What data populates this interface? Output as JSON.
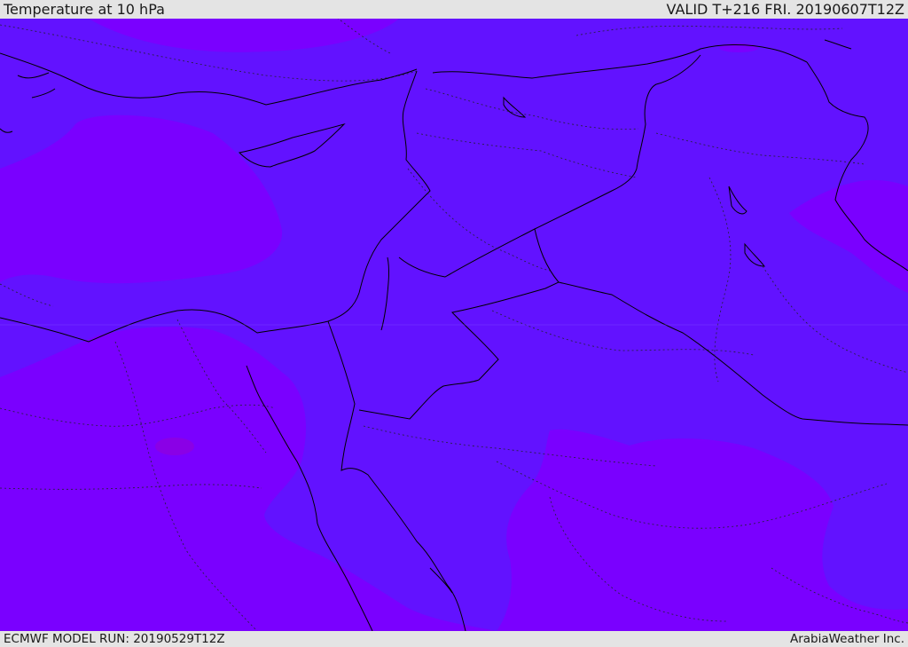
{
  "header": {
    "title": "Temperature at 10 hPa",
    "valid_time": "VALID T+216 FRI. 20190607T12Z"
  },
  "footer": {
    "model_run": "ECMWF MODEL RUN: 20190529T12Z",
    "credit": "ArabiaWeather Inc."
  },
  "map": {
    "field": "Temperature at 10 hPa",
    "colors": {
      "warmer_band": "#6212ff",
      "cooler_band": "#7a00ff",
      "coolest_spot": "#8a00e6",
      "coastline": "#000000",
      "borders": "#222233"
    }
  }
}
